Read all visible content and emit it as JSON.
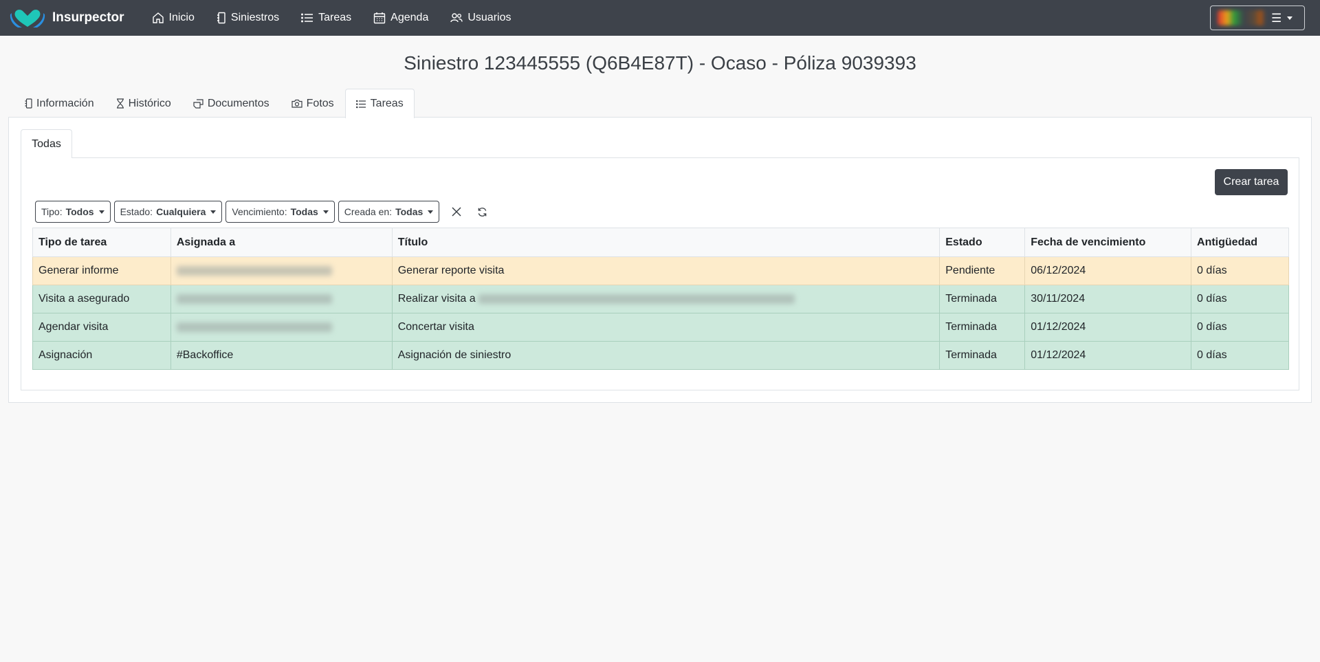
{
  "app": {
    "name": "Insurpector"
  },
  "nav": [
    {
      "label": "Inicio",
      "icon": "home-icon"
    },
    {
      "label": "Siniestros",
      "icon": "notebook-icon"
    },
    {
      "label": "Tareas",
      "icon": "list-icon"
    },
    {
      "label": "Agenda",
      "icon": "calendar-icon"
    },
    {
      "label": "Usuarios",
      "icon": "users-icon"
    }
  ],
  "user_menu": {
    "icon": "hamburger-icon"
  },
  "page": {
    "title": "Siniestro 123445555 (Q6B4E87T) - Ocaso - Póliza 9039393"
  },
  "tabs": [
    {
      "label": "Información",
      "icon": "notebook-icon",
      "active": false
    },
    {
      "label": "Histórico",
      "icon": "hourglass-icon",
      "active": false
    },
    {
      "label": "Documentos",
      "icon": "documents-icon",
      "active": false
    },
    {
      "label": "Fotos",
      "icon": "camera-icon",
      "active": false
    },
    {
      "label": "Tareas",
      "icon": "list-icon",
      "active": true
    }
  ],
  "subtabs": [
    {
      "label": "Todas",
      "active": true
    }
  ],
  "actions": {
    "create_label": "Crear tarea"
  },
  "filters": [
    {
      "label": "Tipo:",
      "value": "Todos"
    },
    {
      "label": "Estado:",
      "value": "Cualquiera"
    },
    {
      "label": "Vencimiento:",
      "value": "Todas"
    },
    {
      "label": "Creada en:",
      "value": "Todas"
    }
  ],
  "table": {
    "headers": [
      "Tipo de tarea",
      "Asignada a",
      "Título",
      "Estado",
      "Fecha de vencimiento",
      "Antigüedad"
    ],
    "rows": [
      {
        "tipo": "Generar informe",
        "asignada": "",
        "titulo": "Generar reporte visita",
        "estado": "Pendiente",
        "fecha": "06/12/2024",
        "antiguedad": "0 días",
        "status": "pending"
      },
      {
        "tipo": "Visita a asegurado",
        "asignada": "",
        "titulo": "Realizar visita a ",
        "estado": "Terminada",
        "fecha": "30/11/2024",
        "antiguedad": "0 días",
        "status": "done"
      },
      {
        "tipo": "Agendar visita",
        "asignada": "",
        "titulo": "Concertar visita",
        "estado": "Terminada",
        "fecha": "01/12/2024",
        "antiguedad": "0 días",
        "status": "done"
      },
      {
        "tipo": "Asignación",
        "asignada": "#Backoffice",
        "titulo": "Asignación de siniestro",
        "estado": "Terminada",
        "fecha": "01/12/2024",
        "antiguedad": "0 días",
        "status": "done"
      }
    ]
  },
  "colors": {
    "navbar": "#3e434b",
    "pending_row": "#fdeccb",
    "done_row": "#cde9dc",
    "brand_teal": "#1fc6b8",
    "brand_blue": "#2a8fe0"
  }
}
